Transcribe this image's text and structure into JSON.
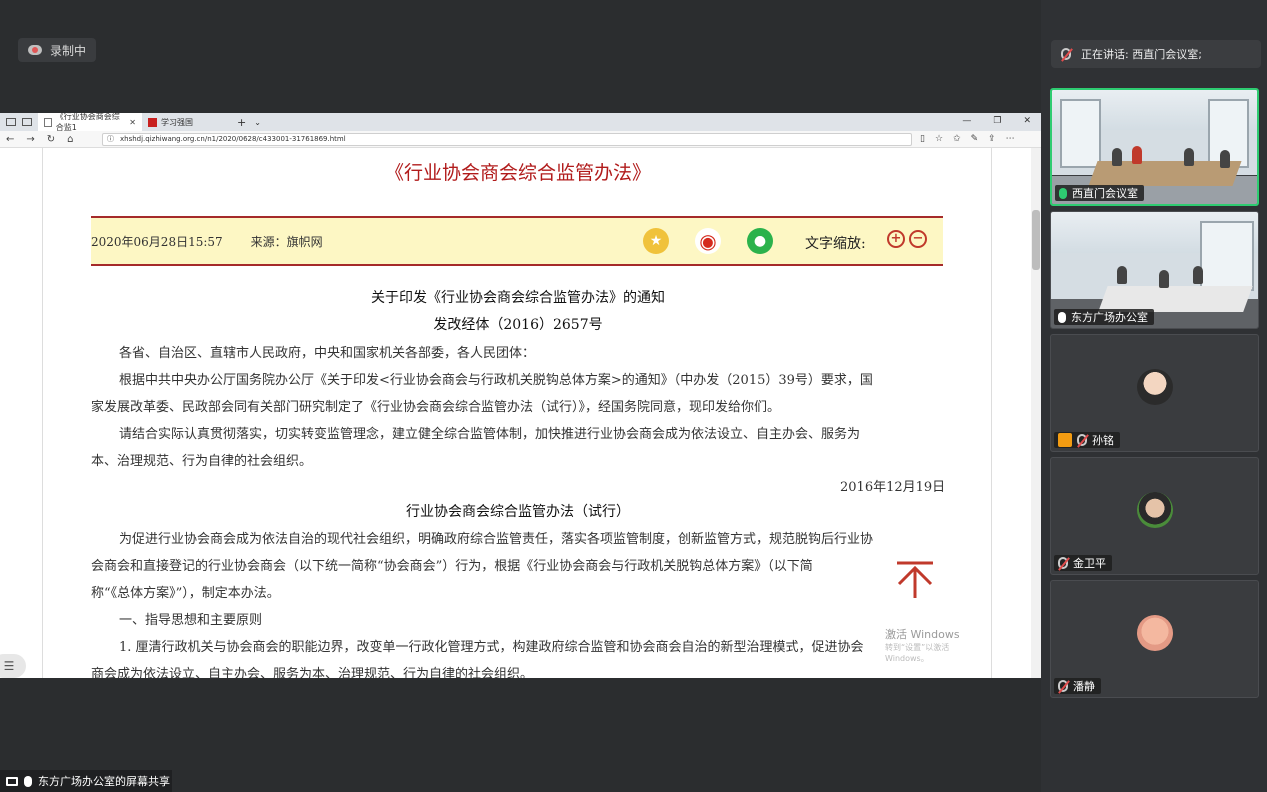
{
  "recording": {
    "label": "录制中"
  },
  "browser": {
    "tabs": [
      {
        "label": "《行业协会商会综合监1",
        "active": true
      },
      {
        "label": "学习强国",
        "active": false
      }
    ],
    "url": "xhshdj.qizhiwang.org.cn/n1/2020/0628/c433001-31761869.html"
  },
  "article": {
    "title": "《行业协会商会综合监管办法》",
    "date": "2020年06月28日15:57",
    "source": "来源：旗帜网",
    "zoom_label": "文字缩放:",
    "notice_title": "关于印发《行业协会商会综合监管办法》的通知",
    "notice_number": "发改经体（2016）2657号",
    "p1": "各省、自治区、直辖市人民政府，中央和国家机关各部委，各人民团体：",
    "p2a": "根据中共中央办公厅国务院办公厅《关于印发<行业协会商会与行政机关脱钩总体方案>的通知》（中办发（2015）39号）要求，国",
    "p2b": "家发展改革委、民政部会同有关部门研究制定了《行业协会商会综合监管办法（试行）》，经国务院同意，现印发给你们。",
    "p3a": "请结合实际认真贯彻落实，切实转变监管理念，建立健全综合监管体制，加快推进行业协会商会成为依法设立、自主办会、服务为",
    "p3b": "本、治理规范、行为自律的社会组织。",
    "sign_date": "2016年12月19日",
    "measure_title": "行业协会商会综合监管办法（试行）",
    "p4a": "为促进行业协会商会成为依法自治的现代社会组织，明确政府综合监管责任，落实各项监管制度，创新监管方式，规范脱钩后行业协",
    "p4b": "会商会和直接登记的行业协会商会（以下统一简称“协会商会”）行为，根据《行业协会商会与行政机关脱钩总体方案》（以下简",
    "p4c": "称“《总体方案》”），制定本办法。",
    "section1": "一、指导思想和主要原则",
    "p5a": "1. 厘清行政机关与协会商会的职能边界，改变单一行政化管理方式，构建政府综合监管和协会商会自治的新型治理模式，促进协会",
    "p5b": "商会成为依法设立、自主办会、服务为本、治理规范、行为自律的社会组织。"
  },
  "watermark": {
    "line1": "激活 Windows",
    "line2": "转到“设置”以激活 Windows。"
  },
  "meeting": {
    "speaking": "正在讲话: 西直门会议室;",
    "participants": [
      {
        "name": "西直门会议室"
      },
      {
        "name": "东方广场办公室"
      },
      {
        "name": "孙铭"
      },
      {
        "name": "金卫平"
      },
      {
        "name": "潘静"
      }
    ],
    "screen_share_label": "东方广场办公室的屏幕共享"
  },
  "colors": {
    "title_red": "#b11b1b",
    "info_bg": "#fdf7c4",
    "active_green": "#2ecc71"
  }
}
